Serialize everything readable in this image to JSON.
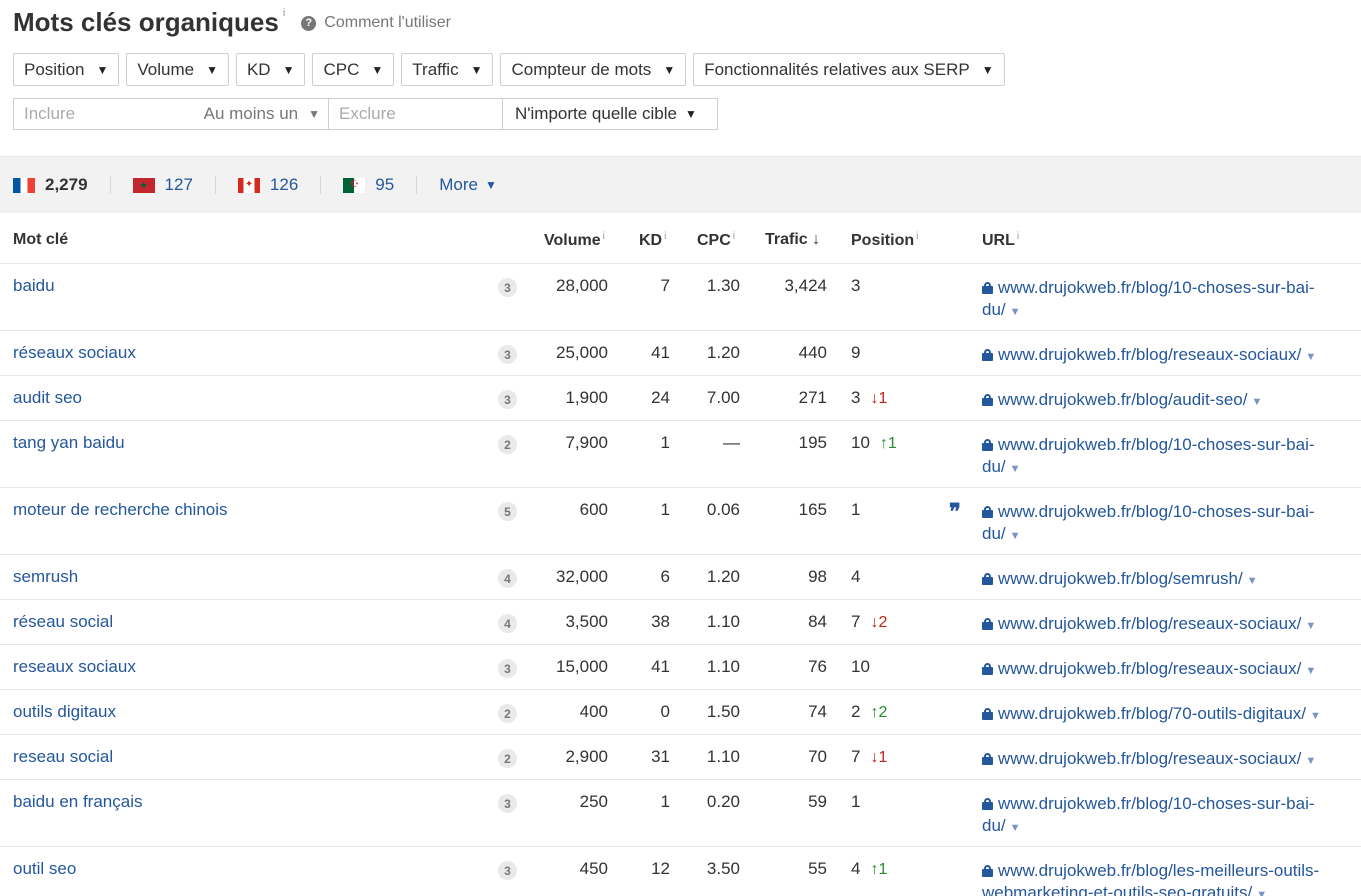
{
  "header": {
    "title": "Mots clés organiques",
    "title_info": "i",
    "help_icon": "?",
    "howto_label": "Comment l'utiliser"
  },
  "filters": [
    {
      "label": "Position"
    },
    {
      "label": "Volume"
    },
    {
      "label": "KD"
    },
    {
      "label": "CPC"
    },
    {
      "label": "Traffic"
    },
    {
      "label": "Compteur de mots"
    },
    {
      "label": "Fonctionnalités relatives aux SERP"
    }
  ],
  "include": {
    "placeholder": "Inclure",
    "mode": "Au moins un"
  },
  "exclude": {
    "placeholder": "Exclure"
  },
  "target": {
    "label": "N'importe quelle cible"
  },
  "countries": [
    {
      "name": "france-flag",
      "count": "2,279",
      "active": true
    },
    {
      "name": "morocco-flag",
      "count": "127"
    },
    {
      "name": "canada-flag",
      "count": "126"
    },
    {
      "name": "algeria-flag",
      "count": "95"
    }
  ],
  "more_label": "More",
  "table": {
    "headers": {
      "keyword": "Mot clé",
      "volume": "Volume",
      "kd": "KD",
      "cpc": "CPC",
      "traffic": "Trafic",
      "traffic_sort": "↓",
      "position": "Position",
      "url": "URL",
      "info": "i"
    },
    "rows": [
      {
        "keyword": "baidu",
        "serp": "3",
        "volume": "28,000",
        "kd": "7",
        "cpc": "1.30",
        "traffic": "3,424",
        "position": "3",
        "change": "",
        "dir": "",
        "quote": "",
        "url_lines": [
          "www.drujokweb.fr/blog/10-choses-sur-bai-",
          "du/"
        ]
      },
      {
        "keyword": "réseaux sociaux",
        "serp": "3",
        "volume": "25,000",
        "kd": "41",
        "cpc": "1.20",
        "traffic": "440",
        "position": "9",
        "change": "",
        "dir": "",
        "quote": "",
        "url_lines": [
          "www.drujokweb.fr/blog/reseaux-sociaux/"
        ]
      },
      {
        "keyword": "audit seo",
        "serp": "3",
        "volume": "1,900",
        "kd": "24",
        "cpc": "7.00",
        "traffic": "271",
        "position": "3",
        "change": "↓1",
        "dir": "down",
        "quote": "",
        "url_lines": [
          "www.drujokweb.fr/blog/audit-seo/"
        ]
      },
      {
        "keyword": "tang yan baidu",
        "serp": "2",
        "volume": "7,900",
        "kd": "1",
        "cpc": "—",
        "traffic": "195",
        "position": "10",
        "change": "↑1",
        "dir": "up",
        "quote": "",
        "url_lines": [
          "www.drujokweb.fr/blog/10-choses-sur-bai-",
          "du/"
        ]
      },
      {
        "keyword": "moteur de recherche chinois",
        "serp": "5",
        "volume": "600",
        "kd": "1",
        "cpc": "0.06",
        "traffic": "165",
        "position": "1",
        "change": "",
        "dir": "",
        "quote": "❞",
        "url_lines": [
          "www.drujokweb.fr/blog/10-choses-sur-bai-",
          "du/"
        ]
      },
      {
        "keyword": "semrush",
        "serp": "4",
        "volume": "32,000",
        "kd": "6",
        "cpc": "1.20",
        "traffic": "98",
        "position": "4",
        "change": "",
        "dir": "",
        "quote": "",
        "url_lines": [
          "www.drujokweb.fr/blog/semrush/"
        ]
      },
      {
        "keyword": "réseau social",
        "serp": "4",
        "volume": "3,500",
        "kd": "38",
        "cpc": "1.10",
        "traffic": "84",
        "position": "7",
        "change": "↓2",
        "dir": "down",
        "quote": "",
        "url_lines": [
          "www.drujokweb.fr/blog/reseaux-sociaux/"
        ]
      },
      {
        "keyword": "reseaux sociaux",
        "serp": "3",
        "volume": "15,000",
        "kd": "41",
        "cpc": "1.10",
        "traffic": "76",
        "position": "10",
        "change": "",
        "dir": "",
        "quote": "",
        "url_lines": [
          "www.drujokweb.fr/blog/reseaux-sociaux/"
        ]
      },
      {
        "keyword": "outils digitaux",
        "serp": "2",
        "volume": "400",
        "kd": "0",
        "cpc": "1.50",
        "traffic": "74",
        "position": "2",
        "change": "↑2",
        "dir": "up",
        "quote": "",
        "url_lines": [
          "www.drujokweb.fr/blog/70-outils-digitaux/"
        ]
      },
      {
        "keyword": "reseau social",
        "serp": "2",
        "volume": "2,900",
        "kd": "31",
        "cpc": "1.10",
        "traffic": "70",
        "position": "7",
        "change": "↓1",
        "dir": "down",
        "quote": "",
        "url_lines": [
          "www.drujokweb.fr/blog/reseaux-sociaux/"
        ]
      },
      {
        "keyword": "baidu en français",
        "serp": "3",
        "volume": "250",
        "kd": "1",
        "cpc": "0.20",
        "traffic": "59",
        "position": "1",
        "change": "",
        "dir": "",
        "quote": "",
        "url_lines": [
          "www.drujokweb.fr/blog/10-choses-sur-bai-",
          "du/"
        ]
      },
      {
        "keyword": "outil seo",
        "serp": "3",
        "volume": "450",
        "kd": "12",
        "cpc": "3.50",
        "traffic": "55",
        "position": "4",
        "change": "↑1",
        "dir": "up",
        "quote": "",
        "url_lines": [
          "www.drujokweb.fr/blog/les-meilleurs-outils-",
          "webmarketing-et-outils-seo-gratuits/"
        ]
      }
    ]
  }
}
